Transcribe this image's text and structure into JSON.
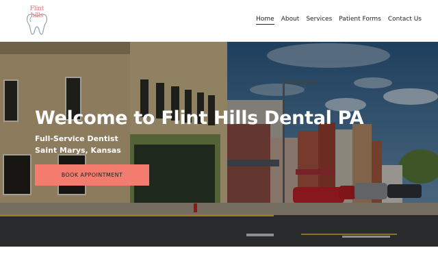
{
  "brand": {
    "logo_text": "Flint hills",
    "accent_color": "#f47c6e",
    "logo_color": "#e9756a"
  },
  "nav": {
    "items": [
      {
        "label": "Home",
        "active": true
      },
      {
        "label": "About",
        "active": false
      },
      {
        "label": "Services",
        "active": false
      },
      {
        "label": "Patient Forms",
        "active": false
      },
      {
        "label": "Contact Us",
        "active": false
      }
    ]
  },
  "hero": {
    "title": "Welcome to Flint Hills Dental PA",
    "subtitle_line1": "Full-Service Dentist",
    "subtitle_line2": "Saint Marys, Kansas",
    "cta_label": "BOOK APPOINTMENT",
    "background_image": "main-street-photo"
  }
}
